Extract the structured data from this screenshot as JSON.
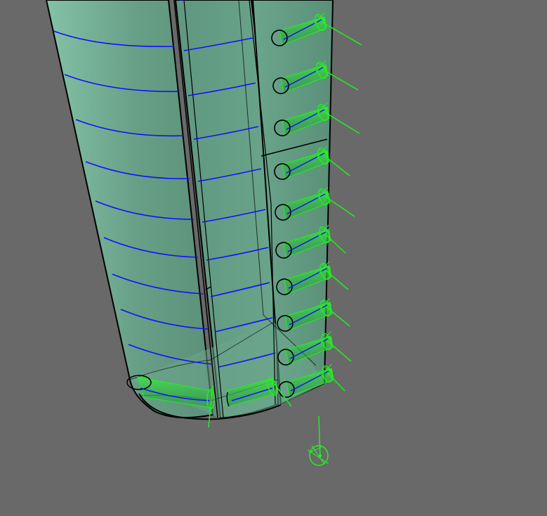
{
  "viewport": {
    "background": "#696969",
    "surface_fill": "#5f9b80",
    "surface_light": "#79b69a",
    "edge_color": "#000000",
    "section_line_color": "#1010ff",
    "gizmo_color": "#22ee22"
  },
  "model": {
    "main_panel_sections": 9,
    "mid_panel_sections": 9,
    "side_hinges": 10,
    "bottom_hinges": 2,
    "pivot_gizmos": 1
  }
}
